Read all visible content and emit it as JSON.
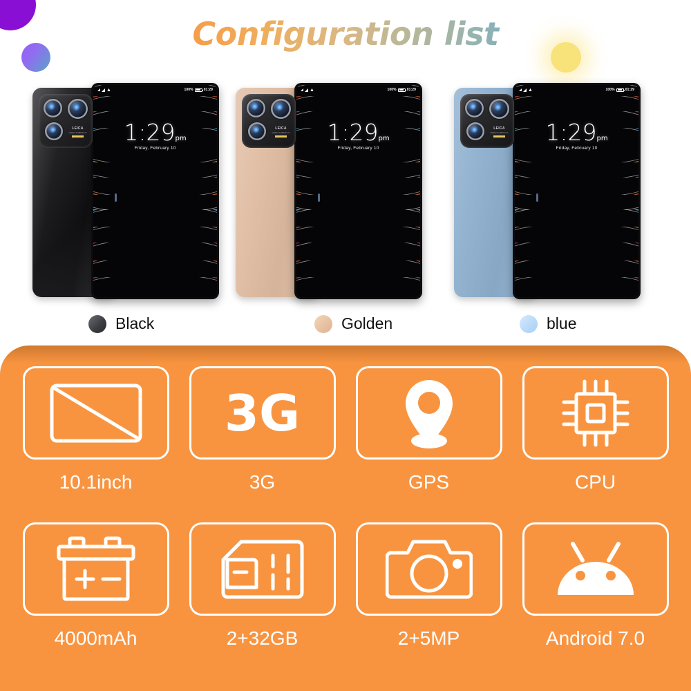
{
  "page": {
    "title": "Configuration list",
    "background": "#ffffff",
    "accent_orange": "#f89440"
  },
  "decor": [
    {
      "name": "purple-circle-large",
      "color": "#8a0fd4"
    },
    {
      "name": "purple-teal-gradient-circle",
      "color_from": "#9b5cf6",
      "color_to": "#59a6c6"
    },
    {
      "name": "yellow-glow-circle",
      "color": "#f8e27a"
    }
  ],
  "devices": [
    {
      "color_name": "Black",
      "body_color": "#1a1a1c",
      "swatch_color": "#3a3c40",
      "camera_brand": "LEICA",
      "camera_sub": "VARIO-SUMMILUX",
      "screen": {
        "time": "1:29",
        "ampm": "pm",
        "date": "Friday, February 10",
        "battery_percent": "100%",
        "status_clock": "01:29",
        "wifi_icon": "wifi-icon",
        "signal_icon": "signal-bars-icon",
        "battery_icon": "battery-full-icon"
      }
    },
    {
      "color_name": "Golden",
      "body_color": "#e0bda3",
      "swatch_color": "#e6c0a0",
      "camera_brand": "LEICA",
      "camera_sub": "VARIO-SUMMILUX",
      "screen": {
        "time": "1:29",
        "ampm": "pm",
        "date": "Friday, February 10",
        "battery_percent": "100%",
        "status_clock": "01:29",
        "wifi_icon": "wifi-icon",
        "signal_icon": "signal-bars-icon",
        "battery_icon": "battery-full-icon"
      }
    },
    {
      "color_name": "blue",
      "body_color": "#8fb0cf",
      "swatch_color": "#b8d9f8",
      "camera_brand": "LEICA",
      "camera_sub": "VARIO-SUMMILUX",
      "screen": {
        "time": "1:29",
        "ampm": "pm",
        "date": "Friday, February 10",
        "battery_percent": "100%",
        "status_clock": "01:29",
        "wifi_icon": "wifi-icon",
        "signal_icon": "signal-bars-icon",
        "battery_icon": "battery-full-icon"
      }
    }
  ],
  "specs": [
    {
      "label": "10.1inch",
      "icon": "screen-diagonal-icon"
    },
    {
      "label": "3G",
      "icon": "3g-text-icon",
      "icon_text": "3G"
    },
    {
      "label": "GPS",
      "icon": "map-pin-icon"
    },
    {
      "label": "CPU",
      "icon": "cpu-chip-icon"
    },
    {
      "label": "4000mAh",
      "icon": "battery-terminal-icon"
    },
    {
      "label": "2+32GB",
      "icon": "sim-card-icon"
    },
    {
      "label": "2+5MP",
      "icon": "camera-icon"
    },
    {
      "label": "Android 7.0",
      "icon": "android-robot-icon"
    }
  ]
}
